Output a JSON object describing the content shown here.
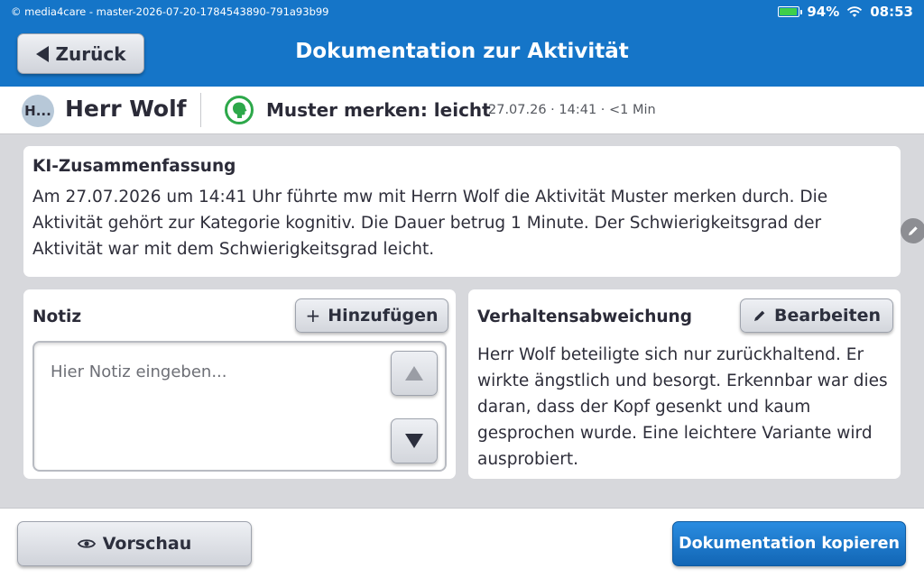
{
  "statusbar": {
    "app_info": "© media4care - master-2026-07-20-1784543890-791a93b99",
    "battery": "94%",
    "battery_level": 0.94,
    "time": "08:53"
  },
  "header": {
    "back_label": "Zurück",
    "title": "Dokumentation zur Aktivität"
  },
  "infobar": {
    "avatar_initials": "H...",
    "person_name": "Herr Wolf",
    "activity_name": "Muster merken: leicht",
    "activity_meta": "27.07.26 · 14:41 · <1 Min"
  },
  "summary": {
    "title": "KI-Zusammenfassung",
    "text": "Am 27.07.2026 um 14:41 Uhr führte mw mit Herrn Wolf die Aktivität Muster merken durch. Die Aktivität gehört zur Kategorie kognitiv. Die Dauer betrug 1 Minute. Der Schwierigkeitsgrad der Aktivität war mit dem Schwierigkeitsgrad leicht."
  },
  "note": {
    "title": "Notiz",
    "add_label": "Hinzufügen",
    "placeholder": "Hier Notiz eingeben..."
  },
  "behavior": {
    "title": "Verhaltensabweichung",
    "edit_label": "Bearbeiten",
    "text": "Herr Wolf beteiligte sich nur zurückhaltend. Er wirkte ängstlich und besorgt. Erkennbar war dies daran, dass der Kopf gesenkt und kaum gesprochen wurde. Eine leichtere Variante wird ausprobiert."
  },
  "footer": {
    "preview_label": "Vorschau",
    "copy_label": "Dokumentation kopieren"
  },
  "colors": {
    "primary": "#1575c8",
    "success": "#2da84a"
  }
}
